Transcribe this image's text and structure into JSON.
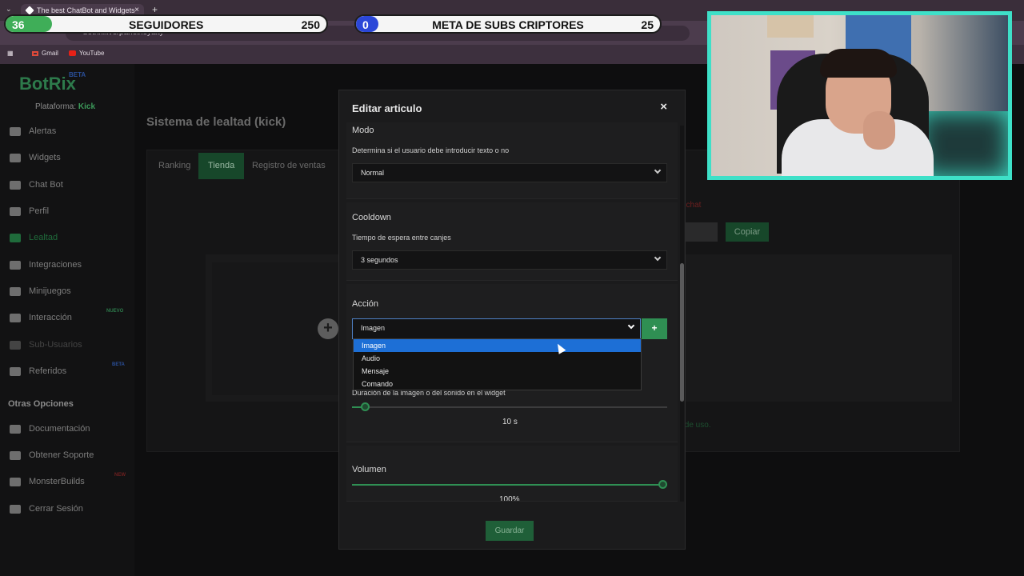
{
  "browser": {
    "tab_title": "The best ChatBot and Widgets",
    "url": "botrix.live/panel/loyalty",
    "bookmarks": [
      "Gmail",
      "YouTube"
    ]
  },
  "overlay": {
    "followers": {
      "current": "36",
      "title": "SEGUIDORES",
      "goal": "250",
      "fill_fraction": 0.144,
      "color": "#3fae58"
    },
    "subs": {
      "current": "0",
      "title": "META DE SUBS CRIPTORES",
      "goal": "25",
      "fill_fraction": 0,
      "color": "#2b47d8"
    }
  },
  "sidebar": {
    "logo": "BotRix",
    "logo_badge": "BETA",
    "platform_label": "Plataforma:",
    "platform_value": "Kick",
    "items": [
      {
        "label": "Alertas",
        "icon": "warning-icon"
      },
      {
        "label": "Widgets",
        "icon": "widgets-icon"
      },
      {
        "label": "Chat Bot",
        "icon": "robot-icon"
      },
      {
        "label": "Perfil",
        "icon": "id-card-icon"
      },
      {
        "label": "Lealtad",
        "icon": "trophy-icon"
      },
      {
        "label": "Integraciones",
        "icon": "plugin-icon"
      },
      {
        "label": "Minijuegos",
        "icon": "gamepad-icon"
      },
      {
        "label": "Interacción",
        "icon": "music-icon",
        "badge": "NUEVO"
      },
      {
        "label": "Sub-Usuarios",
        "icon": "users-icon"
      },
      {
        "label": "Referidos",
        "icon": "referral-icon",
        "badge": "BETA"
      }
    ],
    "section_title": "Otras Opciones",
    "other_items": [
      {
        "label": "Documentación",
        "icon": "book-icon"
      },
      {
        "label": "Obtener Soporte",
        "icon": "support-icon"
      },
      {
        "label": "MonsterBuilds",
        "icon": "monitor-icon",
        "badge": "NEW"
      },
      {
        "label": "Cerrar Sesión",
        "icon": "logout-icon"
      }
    ]
  },
  "main": {
    "title": "Sistema de lealtad (kick)",
    "tabs": [
      "Ranking",
      "Tienda",
      "Registro de ventas"
    ],
    "active_tab": "Tienda",
    "chat_note": "le chat",
    "copy_button": "Copiar",
    "terms_text": "s de uso."
  },
  "modal": {
    "title": "Editar articulo",
    "close": "×",
    "modo": {
      "label": "Modo",
      "desc": "Determina si el usuario debe introducir texto o no",
      "value": "Normal"
    },
    "cooldown": {
      "label": "Cooldown",
      "desc": "Tiempo de espera entre canjes",
      "value": "3 segundos"
    },
    "accion": {
      "label": "Acción",
      "value": "Imagen",
      "add_label": "+",
      "options": [
        "Imagen",
        "Audio",
        "Mensaje",
        "Comando"
      ],
      "highlighted": "Imagen"
    },
    "duracion": {
      "desc": "Duración de la imagen o del sonido en el widget",
      "value": "10 s",
      "fraction": 0.03
    },
    "volumen": {
      "label": "Volumen",
      "value": "100%",
      "fraction": 1.0
    },
    "save_label": "Guardar"
  }
}
